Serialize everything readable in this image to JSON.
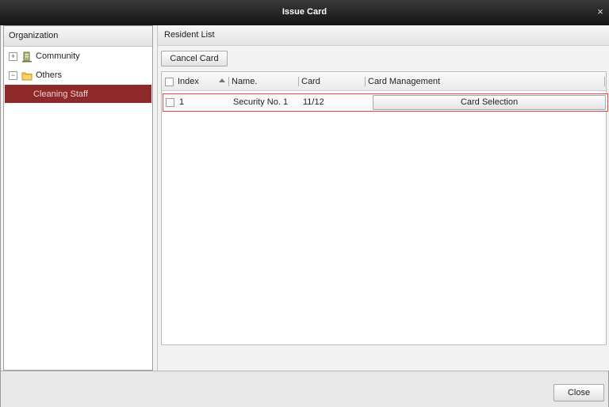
{
  "window": {
    "title": "Issue Card",
    "close_glyph": "×"
  },
  "organization": {
    "header": "Organization",
    "tree": [
      {
        "label": "Community",
        "expander": "+",
        "icon": "building-icon"
      },
      {
        "label": "Others",
        "expander": "−",
        "icon": "folder-icon"
      },
      {
        "label": "Cleaning Staff",
        "selected": true
      }
    ]
  },
  "resident_list": {
    "header": "Resident List",
    "cancel_card_label": "Cancel Card",
    "columns": {
      "index": "Index",
      "name": "Name.",
      "card": "Card",
      "card_management": "Card Management"
    },
    "rows": [
      {
        "index": "1",
        "name": "Security No. 1",
        "card": "11/12",
        "action_label": "Card Selection"
      }
    ]
  },
  "footer": {
    "close_label": "Close"
  },
  "colors": {
    "selected_row": "#8e2a2a",
    "row_highlight_border": "#e04848",
    "titlebar": "#1e1e1e"
  }
}
